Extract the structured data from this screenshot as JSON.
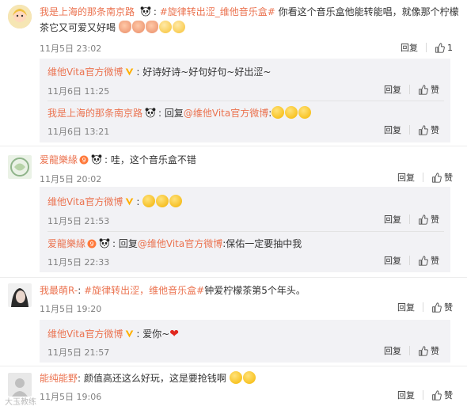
{
  "actions": {
    "reply": "回复",
    "like": "赞"
  },
  "colors": {
    "link": "#eb7350",
    "meta": "#808080",
    "reply_bg": "#f2f2f5"
  },
  "comments": [
    {
      "user": "我是上海的那条南京路",
      "text_link": "#旋律转出涩_维他音乐盒#",
      "text_rest": "你看这个音乐盒他能转能唱，就像那个柠檬",
      "text_line2": "茶它又可爱又好喝",
      "time": "11月5日 23:02",
      "likes": "1",
      "replies": [
        {
          "user": "维他Vita官方微博",
          "text": "好诗好诗~好句好句~好出涩~",
          "time": "11月6日 11:25"
        },
        {
          "user": "我是上海的那条南京路",
          "prefix": "回复",
          "mention": "@维他Vita官方微博",
          "text": ":",
          "time": "11月6日 13:21"
        }
      ]
    },
    {
      "user": "爱龍樂緣",
      "text": "哇，这个音乐盒不错",
      "time": "11月5日 20:02",
      "replies": [
        {
          "user": "维他Vita官方微博",
          "text": "",
          "time": "11月5日 21:53"
        },
        {
          "user": "爱龍樂緣",
          "prefix": "回复",
          "mention": "@维他Vita官方微博",
          "text": ":保佑一定要抽中我",
          "time": "11月5日 22:33"
        }
      ]
    },
    {
      "user": "我最萌R-",
      "text_link": "#旋律转出涩，维他音乐盒#",
      "text_rest": "钟爱柠檬茶第5个年头。",
      "time": "11月5日 19:20",
      "replies": [
        {
          "user": "维他Vita官方微博",
          "text": "爱你~",
          "time": "11月5日 21:57"
        }
      ]
    },
    {
      "user": "能纯能野",
      "text": "颜值高还这么好玩，这是要抢钱啊",
      "time": "11月5日 19:06"
    }
  ],
  "watermark": "大玉教练"
}
